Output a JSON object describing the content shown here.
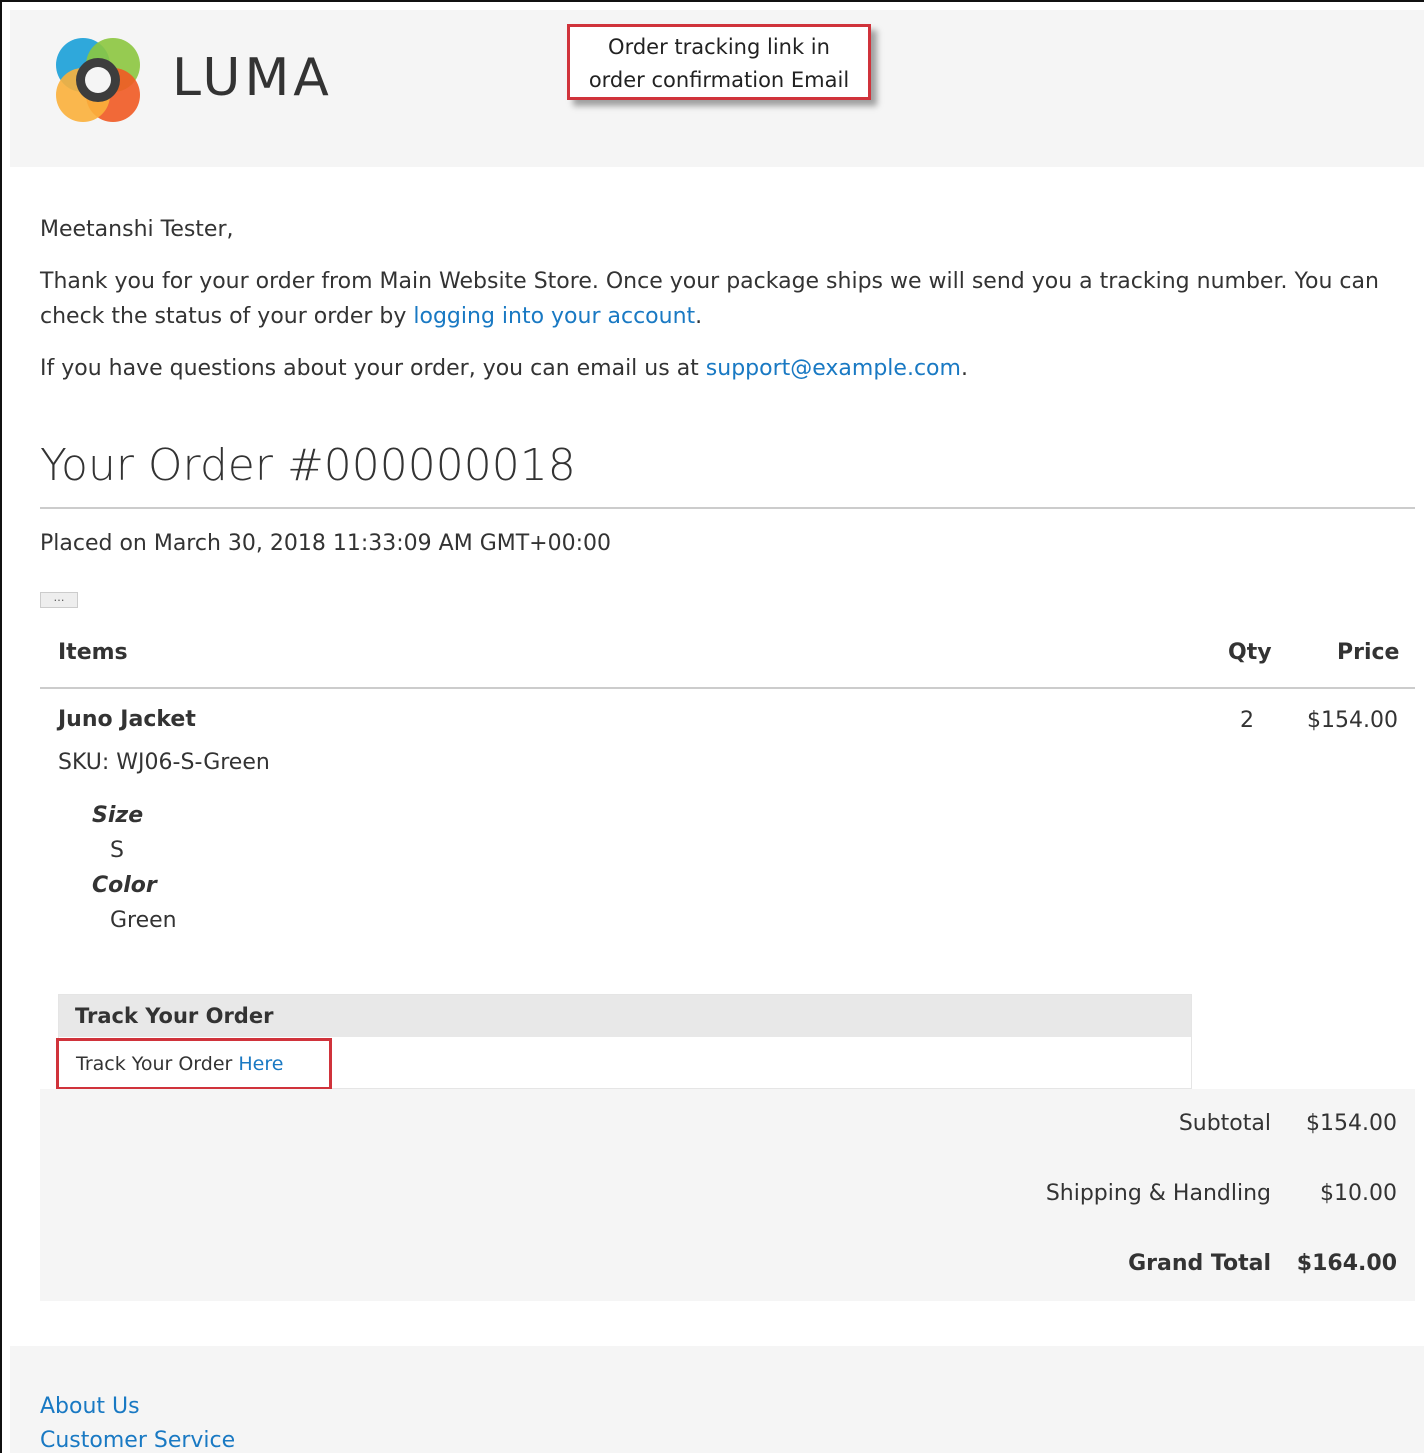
{
  "callout": {
    "line1": "Order tracking link in",
    "line2": "order confirmation Email",
    "border_color": "#d0333b"
  },
  "logo": {
    "text": "LUMA"
  },
  "greeting": "Meetanshi Tester,",
  "thanks": {
    "before_link": "Thank you for your order from Main Website Store. Once your package ships we will send you a tracking number. You can check the status of your order by ",
    "link": "logging into your account",
    "after_link": "."
  },
  "questions": {
    "before_link": "If you have questions about your order, you can email us at ",
    "email": "support@example.com",
    "after_link": "."
  },
  "order": {
    "title": "Your Order #000000018",
    "placed": "Placed on March 30, 2018 11:33:09 AM GMT+00:00",
    "more_button": "…"
  },
  "table": {
    "headers": {
      "items": "Items",
      "qty": "Qty",
      "price": "Price"
    },
    "item": {
      "name": "Juno Jacket",
      "sku": "SKU: WJ06-S-Green",
      "qty": "2",
      "price": "$154.00",
      "options": [
        {
          "label": "Size",
          "value": "S"
        },
        {
          "label": "Color",
          "value": "Green"
        }
      ]
    }
  },
  "track": {
    "heading": "Track Your Order",
    "text": "Track Your Order ",
    "link": "Here"
  },
  "totals": {
    "subtotal_label": "Subtotal",
    "subtotal_value": "$154.00",
    "shipping_label": "Shipping & Handling",
    "shipping_value": "$10.00",
    "grand_label": "Grand Total",
    "grand_value": "$164.00"
  },
  "footer": {
    "links": [
      "About Us",
      "Customer Service"
    ]
  },
  "colors": {
    "link": "#1979c3",
    "highlight": "#d0333b",
    "panel": "#f5f5f5"
  }
}
